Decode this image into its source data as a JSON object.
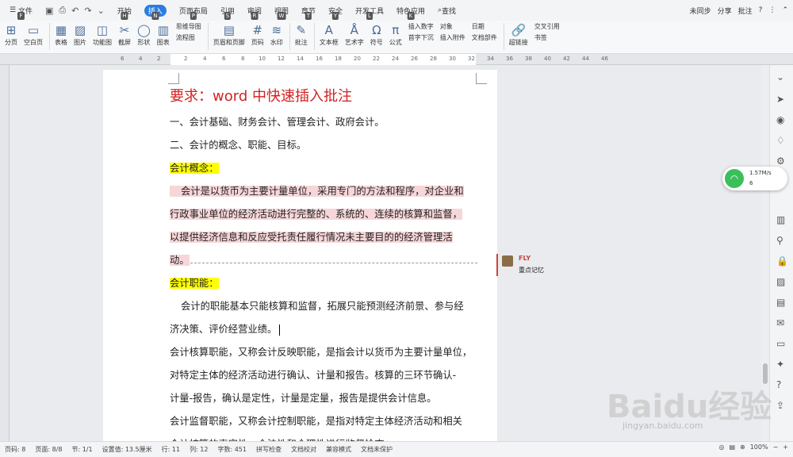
{
  "menu": {
    "file": "文件",
    "items": [
      {
        "label": "开始",
        "key": "H"
      },
      {
        "label": "插入",
        "key": "N"
      },
      {
        "label": "页面布局",
        "key": "P"
      },
      {
        "label": "引用",
        "key": "S"
      },
      {
        "label": "审阅",
        "key": "R"
      },
      {
        "label": "视图",
        "key": "W"
      },
      {
        "label": "章节",
        "key": "T"
      },
      {
        "label": "安全",
        "key": "Y"
      },
      {
        "label": "开发工具",
        "key": "L"
      },
      {
        "label": "特色应用",
        "key": "K"
      }
    ],
    "search": "查找",
    "file_key": "F"
  },
  "menu_right": {
    "sync": "未同步",
    "share": "分享",
    "comment": "批注",
    "help": "?"
  },
  "toolbar": {
    "page_break": "分页",
    "blank_page": "空白页",
    "table": "表格",
    "picture": "图片",
    "feature_graph": "功能图",
    "screenshot": "截屏",
    "shape": "形状",
    "chart": "图表",
    "mindmap": "思维导图",
    "flowchart": "流程图",
    "header_footer": "页眉和页脚",
    "page_num": "页码",
    "watermark": "水印",
    "annotation": "批注",
    "textbox": "文本框",
    "wordart": "艺术字",
    "symbol": "符号",
    "formula": "公式",
    "insert_num": "插入数字",
    "dropcap": "首字下沉",
    "object": "对象",
    "attachment": "插入附件",
    "date": "日期",
    "docpart": "文档部件",
    "hyperlink": "超链接",
    "crossref": "交叉引用",
    "bookmark": "书签"
  },
  "ruler": {
    "numbers": [
      "6",
      "4",
      "2",
      "2",
      "4",
      "6",
      "8",
      "10",
      "12",
      "14",
      "16",
      "18",
      "20",
      "22",
      "24",
      "26",
      "28",
      "30",
      "32",
      "34",
      "36",
      "38",
      "40",
      "42",
      "44",
      "46"
    ]
  },
  "document": {
    "title": "要求：word 中快速插入批注",
    "line1": "一、会计基础、财务会计、管理会计、政府会计。",
    "line2": "二、会计的概念、职能、目标。",
    "heading1": "会计概念：",
    "para1": [
      "会计是以货币为主要计量单位，采用专门的方法和程序，对企业和",
      "行政事业单位的经济活动进行完整的、系统的、连续的核算和监督，",
      "以提供经济信息和反应受托责任履行情况未主要目的的经济管理活",
      "动。"
    ],
    "heading2": "会计职能：",
    "para2": [
      "会计的职能基本只能核算和监督，拓展只能预测经济前景、参与经",
      "济决策、评价经营业绩。"
    ],
    "para3": [
      "会计核算职能，又称会计反映职能，是指会计以货币为主要计量单位，",
      "对特定主体的经济活动进行确认、计量和报告。核算的三环节确认-",
      "计量-报告，确认是定性，计量是定量，报告是提供会计信息。"
    ],
    "para4": [
      "会计监督职能，又称会计控制职能，是指对特定主体经济活动和相关",
      "会计核算的真实性、合法性和合理性进行监督检查。"
    ]
  },
  "comment": {
    "author": "FLY",
    "text": "重点记忆"
  },
  "network": {
    "speed": "1.57M/s",
    "count": "6"
  },
  "status": {
    "page_code": "页码: 8",
    "page": "页面: 8/8",
    "section": "节: 1/1",
    "setting": "设置值: 13.5厘米",
    "row": "行: 11",
    "col": "列: 12",
    "words": "字数: 451",
    "spell": "拼写检查",
    "doc_check": "文档校对",
    "compat": "兼容模式",
    "protect": "文档未保护",
    "zoom": "100%"
  },
  "watermark": {
    "text": "Baidu经验",
    "url": "jingyan.baidu.com"
  }
}
